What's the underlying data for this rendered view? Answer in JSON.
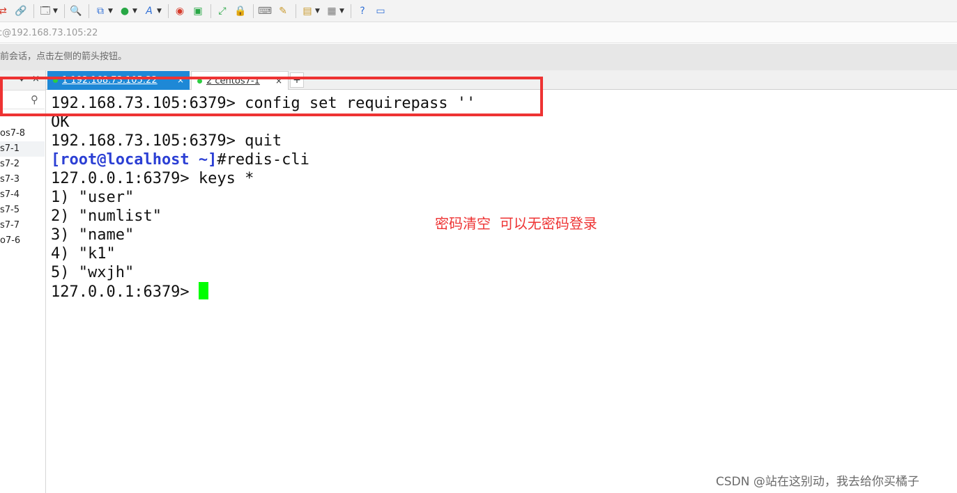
{
  "toolbar": {
    "icons": [
      "shuffle-icon",
      "link-icon",
      "new-window-icon",
      "search-icon",
      "transfer-icon",
      "globe-icon",
      "font-icon",
      "record-icon",
      "script-icon",
      "fullscreen-icon",
      "lock-icon",
      "keyboard-icon",
      "highlight-icon",
      "new-folder-icon",
      "layout-icon",
      "help-icon",
      "chat-icon"
    ]
  },
  "address_bar": {
    "text": "c@192.168.73.105:22"
  },
  "hint_bar": {
    "text": "前会话，点击左侧的箭头按钮。"
  },
  "sidebar": {
    "pin_icon": "📌",
    "close_icon": "×",
    "search_icon": "🔍",
    "sessions": [
      {
        "label": "os7-8",
        "selected": false
      },
      {
        "label": "s7-1",
        "selected": true
      },
      {
        "label": "s7-2",
        "selected": false
      },
      {
        "label": "s7-3",
        "selected": false
      },
      {
        "label": "s7-4",
        "selected": false
      },
      {
        "label": "s7-5",
        "selected": false
      },
      {
        "label": "s7-7",
        "selected": false
      },
      {
        "label": "o7-6",
        "selected": false
      }
    ]
  },
  "tabs": [
    {
      "label": "1 192.168.73.105:22",
      "active": true
    },
    {
      "label": "2 centos7-1",
      "active": false
    }
  ],
  "tab_add": "+",
  "tab_close": "×",
  "terminal": {
    "lines": [
      "192.168.73.105:6379> config set requirepass ''",
      "OK",
      "192.168.73.105:6379> quit",
      "",
      "127.0.0.1:6379> keys *",
      "1) \"user\"",
      "2) \"numlist\"",
      "3) \"name\"",
      "4) \"k1\"",
      "5) \"wxjh\"",
      "127.0.0.1:6379> "
    ],
    "root_prompt": "[root@localhost ~]",
    "root_command": "#redis-cli"
  },
  "annotation": {
    "text": "密码清空  可以无密码登录",
    "color": "#ee3333"
  },
  "watermark": "CSDN @站在这别动，我去给你买橘子",
  "colors": {
    "tab_active": "#1e88d6",
    "cursor": "#00ff00",
    "prompt_root": "#2b3fd4"
  }
}
